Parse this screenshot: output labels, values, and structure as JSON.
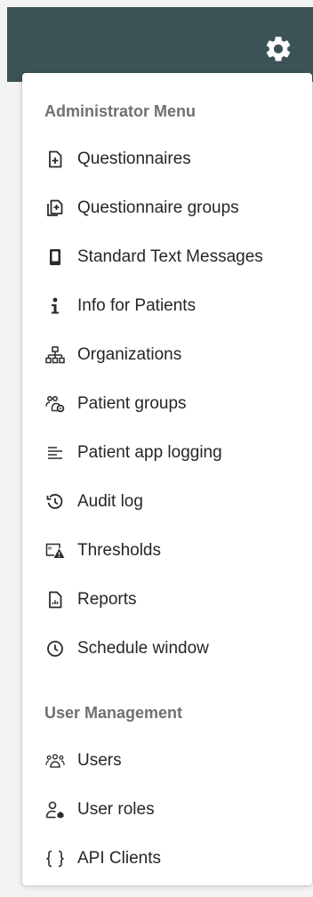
{
  "header": {
    "settings_icon": "gear-icon"
  },
  "menu": {
    "admin_section": {
      "title": "Administrator Menu",
      "items": [
        {
          "label": "Questionnaires",
          "icon": "file-plus-icon"
        },
        {
          "label": "Questionnaire groups",
          "icon": "files-plus-icon"
        },
        {
          "label": "Standard Text Messages",
          "icon": "mobile-icon"
        },
        {
          "label": "Info for Patients",
          "icon": "info-icon"
        },
        {
          "label": "Organizations",
          "icon": "sitemap-icon"
        },
        {
          "label": "Patient groups",
          "icon": "user-group-gear-icon"
        },
        {
          "label": "Patient app logging",
          "icon": "align-left-icon"
        },
        {
          "label": "Audit log",
          "icon": "history-icon"
        },
        {
          "label": "Thresholds",
          "icon": "image-warning-icon"
        },
        {
          "label": "Reports",
          "icon": "file-chart-icon"
        },
        {
          "label": "Schedule window",
          "icon": "clock-icon"
        }
      ]
    },
    "user_section": {
      "title": "User Management",
      "items": [
        {
          "label": "Users",
          "icon": "users-icon"
        },
        {
          "label": "User roles",
          "icon": "user-role-icon"
        },
        {
          "label": "API Clients",
          "icon": "braces-icon"
        }
      ]
    }
  },
  "colors": {
    "topbar": "#3c5356",
    "section_header": "#707070",
    "item_text": "#262626"
  }
}
